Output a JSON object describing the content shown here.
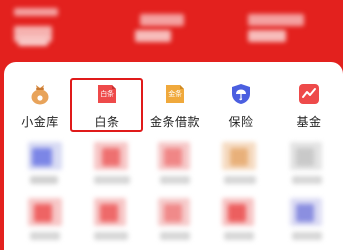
{
  "quick_nav": {
    "items": [
      {
        "label": "小金库",
        "icon": "moneybag-icon"
      },
      {
        "label": "白条",
        "icon": "baitiao-card-icon",
        "icon_text": "白条"
      },
      {
        "label": "金条借款",
        "icon": "jintiao-card-icon",
        "icon_text": "金条"
      },
      {
        "label": "保险",
        "icon": "umbrella-shield-icon"
      },
      {
        "label": "基金",
        "icon": "fund-chart-icon"
      }
    ],
    "highlighted_item": "白条"
  },
  "colors": {
    "header_red": "#e3211e",
    "highlight_border": "#e01a1a",
    "icon_orange": "#e8a35a",
    "icon_red": "#ee4a4a",
    "icon_gold": "#f0a93c",
    "icon_blue": "#4b5fe0"
  }
}
